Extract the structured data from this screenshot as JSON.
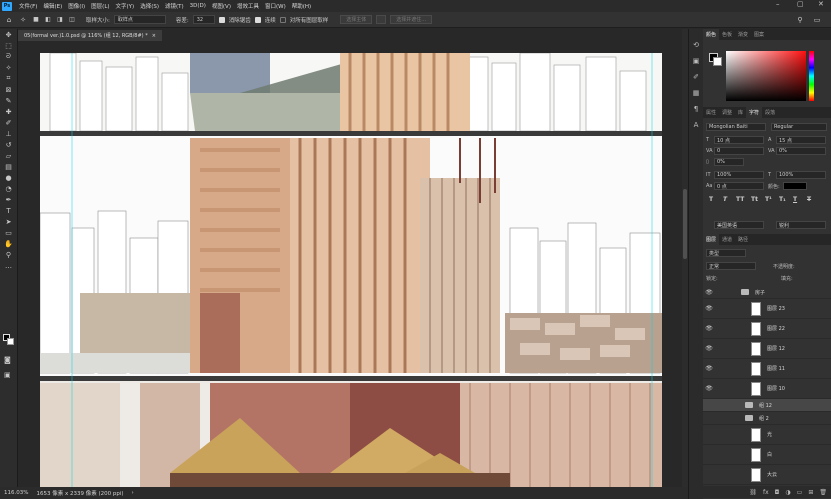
{
  "app": {
    "logo": "Ps",
    "menu": [
      "文件(F)",
      "编辑(E)",
      "图像(I)",
      "图层(L)",
      "文字(Y)",
      "选择(S)",
      "滤镜(T)",
      "3D(D)",
      "视图(V)",
      "增效工具",
      "窗口(W)",
      "帮助(H)"
    ],
    "window_controls": [
      "–",
      "▢",
      "✕"
    ]
  },
  "options": {
    "sample_size_label": "取样大小:",
    "sample_size_value": "取样点",
    "tolerance_label": "容差:",
    "tolerance_value": "32",
    "anti_alias_label": "消除锯齿",
    "contiguous_label": "连续",
    "sample_all_label": "对所有图层取样",
    "select_subject_label": "选择主体",
    "select_mask_label": "选择并遮住..."
  },
  "document": {
    "tab_title": "05(formal ver.)1.0.psd @ 116% (组 12, RGB/8#) *",
    "tab_close": "×"
  },
  "status": {
    "zoom": "116.03%",
    "size": "1653 像素 x 2339 像素 (200 ppi)"
  },
  "panels": {
    "color_tabs": [
      "颜色",
      "色板",
      "渐变",
      "图案"
    ],
    "char_tabs": [
      "属性",
      "调整",
      "库",
      "字符",
      "段落"
    ],
    "character": {
      "font": "Mongolian Baiti",
      "style": "Regular",
      "size": "10 点",
      "leading": "15 点",
      "kerning": "0",
      "tracking": "0%",
      "scale_v": "100%",
      "scale_h": "100%",
      "baseline": "0 点",
      "color_label": "颜色:",
      "language": "美国英语",
      "aa": "锐利",
      "style_buttons": [
        "T",
        "T",
        "TT",
        "Tt",
        "T¹",
        "T₁",
        "T",
        "T"
      ]
    },
    "layer_tabs": [
      "图层",
      "通道",
      "路径"
    ],
    "filter_type": "类型",
    "mode": "正常",
    "opacity_label": "不透明度:",
    "lock_label": "锁定:",
    "fill_label": "填充:",
    "layers": [
      {
        "name": "房子",
        "kind": "group"
      },
      {
        "name": "图层 23",
        "kind": "layer"
      },
      {
        "name": "图层 22",
        "kind": "layer"
      },
      {
        "name": "图层 12",
        "kind": "layer"
      },
      {
        "name": "图层 11",
        "kind": "layer"
      },
      {
        "name": "图层 10",
        "kind": "layer"
      },
      {
        "name": "组 12",
        "kind": "group"
      },
      {
        "name": "组 2",
        "kind": "group"
      },
      {
        "name": "光",
        "kind": "layer"
      },
      {
        "name": "白",
        "kind": "layer"
      },
      {
        "name": "大云",
        "kind": "layer"
      }
    ]
  }
}
